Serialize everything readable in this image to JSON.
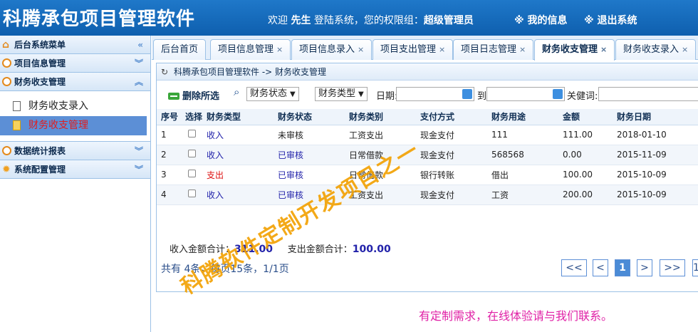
{
  "header": {
    "title": "科腾承包项目管理软件",
    "welcome_prefix": "欢迎",
    "user": "先生",
    "welcome_mid": "登陆系统，您的权限组：",
    "role": "超级管理员",
    "my_info": "※ 我的信息",
    "logout": "※ 退出系统"
  },
  "sidebar": {
    "menu_title": "后台系统菜单",
    "groups": [
      {
        "label": "项目信息管理"
      },
      {
        "label": "财务收支管理",
        "items": [
          {
            "label": "财务收支录入"
          },
          {
            "label": "财务收支管理"
          }
        ]
      },
      {
        "label": "数据统计报表"
      },
      {
        "label": "系统配置管理"
      }
    ]
  },
  "tabs": [
    {
      "label": "后台首页"
    },
    {
      "label": "项目信息管理"
    },
    {
      "label": "项目信息录入"
    },
    {
      "label": "项目支出管理"
    },
    {
      "label": "项目日志管理"
    },
    {
      "label": "财务收支管理"
    },
    {
      "label": "财务收支录入"
    }
  ],
  "tab_close": "×",
  "breadcrumb": "科腾承包项目管理软件 -> 财务收支管理",
  "toolbar": {
    "delete_label": "删除所选",
    "status_select": "财务状态",
    "type_select": "财务类型",
    "date_label": "日期:",
    "to_label": "到",
    "keyword_label": "关健词:"
  },
  "table": {
    "headers": [
      "序号",
      "选择",
      "财务类型",
      "财务状态",
      "财务类别",
      "支付方式",
      "财务用途",
      "金额",
      "财务日期"
    ],
    "rows": [
      {
        "no": "1",
        "type": "收入",
        "status": "未审核",
        "category": "工资支出",
        "payment": "现金支付",
        "purpose": "111",
        "amount": "111.00",
        "date": "2018-01-10"
      },
      {
        "no": "2",
        "type": "收入",
        "status": "已审核",
        "category": "日常借款",
        "payment": "现金支付",
        "purpose": "568568",
        "amount": "0.00",
        "date": "2015-11-09"
      },
      {
        "no": "3",
        "type": "支出",
        "status": "已审核",
        "category": "日常借款",
        "payment": "银行转账",
        "purpose": "借出",
        "amount": "100.00",
        "date": "2015-10-09"
      },
      {
        "no": "4",
        "type": "收入",
        "status": "已审核",
        "category": "工资支出",
        "payment": "现金支付",
        "purpose": "工资",
        "amount": "200.00",
        "date": "2015-10-09"
      }
    ]
  },
  "sums": {
    "income_label": "收入金额合计：",
    "income_value": "311.00",
    "expense_label": "支出金额合计：",
    "expense_value": "100.00"
  },
  "pagination": {
    "info": "共有 4条，每页15条，1/1页",
    "first": "<<",
    "prev": "<",
    "current": "1",
    "next": ">",
    "last": ">>",
    "jump": "1"
  },
  "watermark": "科腾软件定制开发项目之一",
  "contact": "有定制需求，在线体验请与我们联系。"
}
